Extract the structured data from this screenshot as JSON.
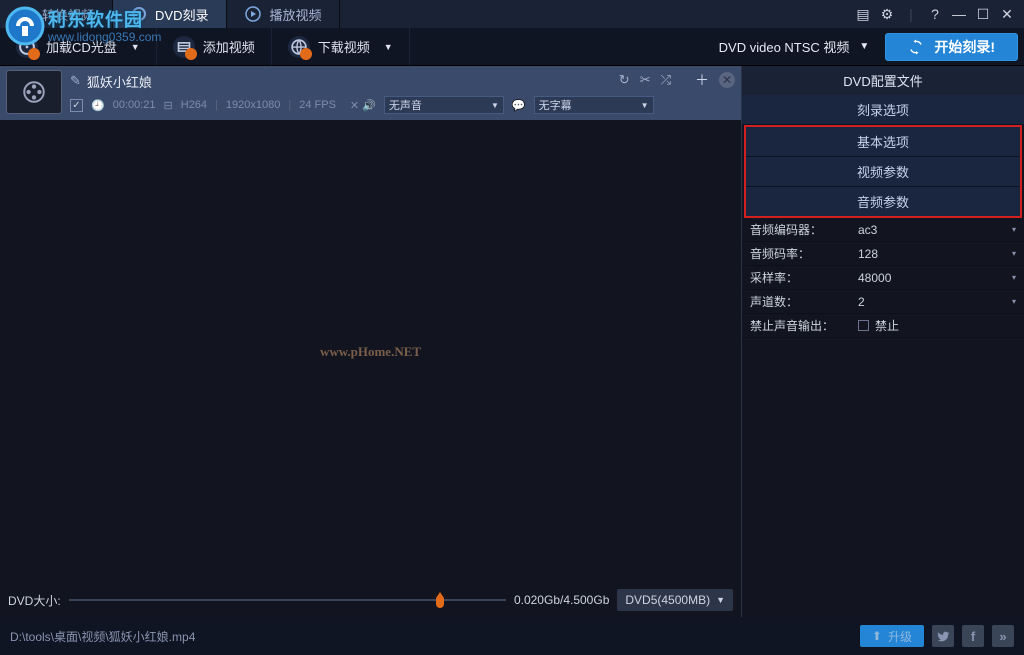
{
  "overlay": {
    "logo_text": "利东软件园",
    "logo_sub": "www.lidong0359.com"
  },
  "tabs": [
    {
      "label": "转换视频",
      "icon": "convert"
    },
    {
      "label": "DVD刻录",
      "icon": "disc"
    },
    {
      "label": "播放视频",
      "icon": "play"
    }
  ],
  "toolbar": {
    "load_cd": "加载CD光盘",
    "add_video": "添加视频",
    "download_video": "下载视频",
    "profile": "DVD video NTSC 视频",
    "start": "开始刻录!"
  },
  "file": {
    "title": "狐妖小红娘",
    "duration": "00:00:21",
    "codec": "H264",
    "resolution": "1920x1080",
    "fps": "24 FPS",
    "audio_label": "无声音",
    "subtitle_label": "无字幕"
  },
  "watermark": "www.pHome.NET",
  "size": {
    "label": "DVD大小:",
    "value": "0.020Gb/4.500Gb",
    "disc": "DVD5(4500MB)"
  },
  "right": {
    "header": "DVD配置文件",
    "option_header": "刻录选项",
    "sections": {
      "basic": "基本选项",
      "video": "视频参数",
      "audio": "音频参数"
    },
    "rows": {
      "audio_encoder_label": "音频编码器：",
      "audio_encoder_value": "ac3",
      "audio_bitrate_label": "音频码率：",
      "audio_bitrate_value": "128",
      "sample_rate_label": "采样率：",
      "sample_rate_value": "48000",
      "channels_label": "声道数：",
      "channels_value": "2",
      "mute_label": "禁止声音输出：",
      "mute_value": "禁止"
    }
  },
  "status": {
    "path": "D:\\tools\\桌面\\视频\\狐妖小红娘.mp4",
    "upgrade": "升级"
  }
}
